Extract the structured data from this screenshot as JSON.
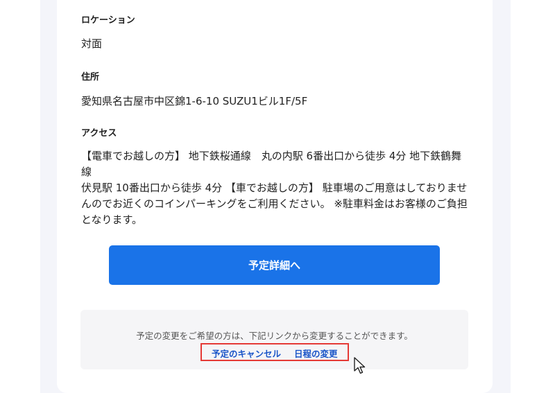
{
  "location": {
    "label": "ロケーション",
    "value": "対面"
  },
  "address": {
    "label": "住所",
    "value": "愛知県名古屋市中区錦1-6-10 SUZU1ビル1F/5F"
  },
  "access": {
    "label": "アクセス",
    "text": "【電車でお越しの方】 地下鉄桜通線　丸の内駅 6番出口から徒歩 4分 地下鉄鶴舞線\n伏見駅 10番出口から徒歩 4分 【車でお越しの方】 駐車場のご用意はしておりませ\nんのでお近くのコインパーキングをご利用ください。 ※駐車料金はお客様のご負担\nとなります。"
  },
  "actions": {
    "details_button": "予定詳細へ"
  },
  "change_notice": {
    "text": "予定の変更をご希望の方は、下記リンクから変更することができます。",
    "cancel_link": "予定のキャンセル",
    "reschedule_link": "日程の変更"
  },
  "colors": {
    "primary": "#1a73e8",
    "link": "#1a55c8",
    "highlight": "#e53935"
  },
  "icons": {
    "cursor": "mouse-pointer-icon"
  }
}
